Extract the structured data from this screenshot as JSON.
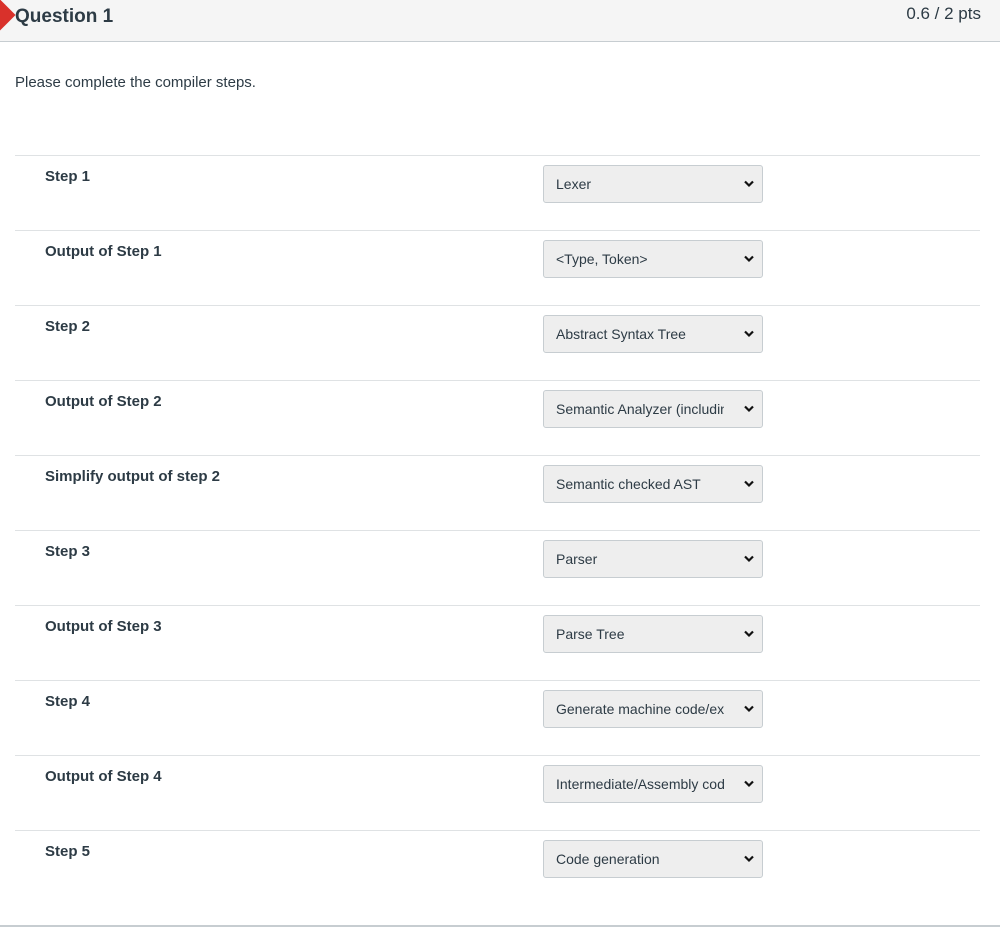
{
  "question": {
    "title": "Question 1",
    "points": "0.6 / 2 pts",
    "prompt": "Please complete the compiler steps.",
    "flag_color": "#d9312b"
  },
  "answers": [
    {
      "label": "Step 1",
      "selected": "Lexer"
    },
    {
      "label": "Output of Step 1",
      "selected": "<Type, Token>"
    },
    {
      "label": "Step 2",
      "selected": "Abstract Syntax Tree"
    },
    {
      "label": "Output of Step 2",
      "selected": "Semantic Analyzer (including Type"
    },
    {
      "label": "Simplify output of step 2",
      "selected": "Semantic checked AST"
    },
    {
      "label": "Step 3",
      "selected": "Parser"
    },
    {
      "label": "Output of Step 3",
      "selected": "Parse Tree"
    },
    {
      "label": "Step 4",
      "selected": "Generate machine code/exe"
    },
    {
      "label": "Output of Step 4",
      "selected": "Intermediate/Assembly code"
    },
    {
      "label": "Step 5",
      "selected": "Code generation"
    }
  ],
  "icons": {
    "dropdown": "chevron-down-icon",
    "flag": "question-flag-marker"
  }
}
